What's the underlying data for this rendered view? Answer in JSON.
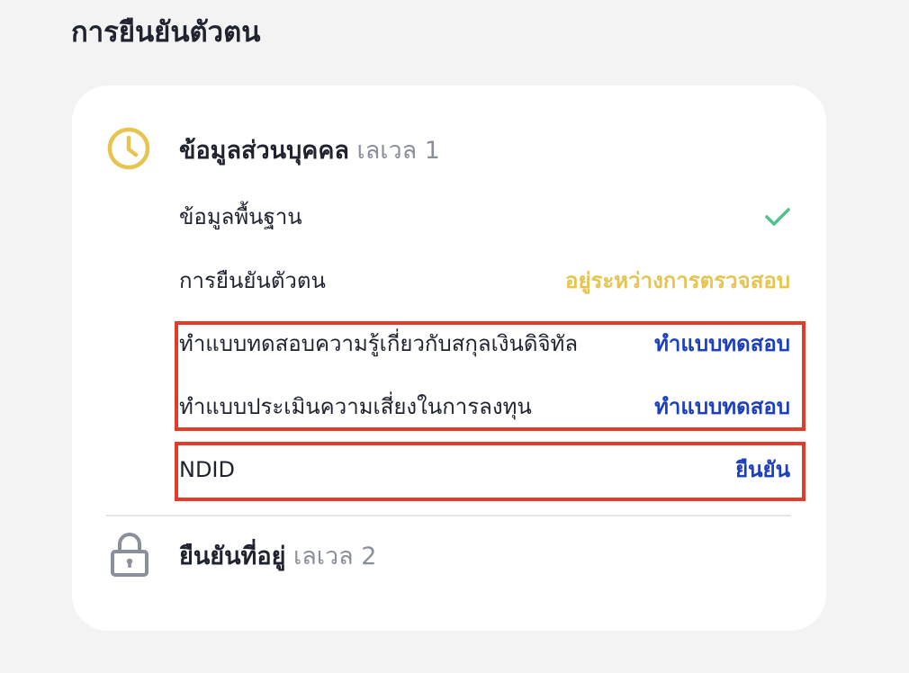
{
  "page": {
    "title": "การยืนยันตัวตน"
  },
  "level1": {
    "title": "ข้อมูลส่วนบุคคล",
    "level": "เลเวล 1",
    "icon": "clock-icon",
    "icon_color": "#e6c44f",
    "rows": [
      {
        "label": "ข้อมูลพื้นฐาน",
        "status": "",
        "status_icon": "check-icon"
      },
      {
        "label": "การยืนยันตัวตน",
        "status": "อยู่ระหว่างการตรวจสอบ"
      },
      {
        "label": "ทำแบบทดสอบความรู้เกี่ยวกับสกุลเงินดิจิทัล",
        "status": "ทำแบบทดสอบ"
      },
      {
        "label": "ทำแบบประเมินความเสี่ยงในการลงทุน",
        "status": "ทำแบบทดสอบ"
      },
      {
        "label": "NDID",
        "status": "ยืนยัน"
      }
    ]
  },
  "level2": {
    "title": "ยืนยันที่อยู่",
    "level": "เลเวล 2",
    "icon": "lock-icon",
    "icon_color": "#8a8f9c"
  },
  "colors": {
    "pending": "#e6c44f",
    "action": "#1c3fbf",
    "check": "#4fc38a",
    "highlight": "#e23b2a"
  }
}
